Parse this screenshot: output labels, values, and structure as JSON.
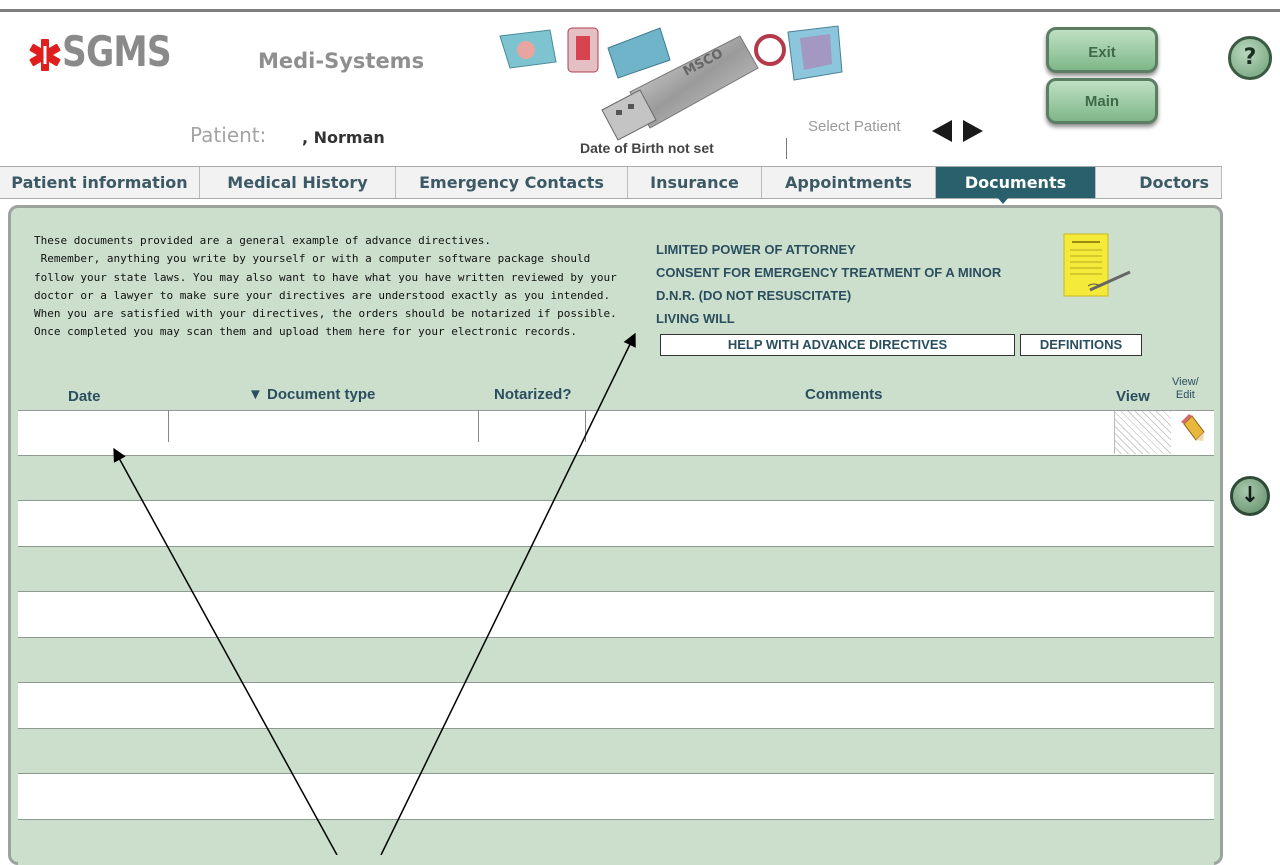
{
  "header": {
    "logo_text": "SGMS",
    "app_name": "Medi-Systems",
    "patient_label": "Patient:",
    "patient_name": ", Norman",
    "dob_text": "Date of Birth not set",
    "select_patient_label": "Select Patient",
    "usb_text": "MSCO"
  },
  "buttons": {
    "exit": "Exit",
    "main": "Main",
    "help": "?",
    "scroll_down": "↓"
  },
  "tabs": [
    {
      "label": "Patient information"
    },
    {
      "label": "Medical History"
    },
    {
      "label": "Emergency Contacts"
    },
    {
      "label": "Insurance"
    },
    {
      "label": "Appointments"
    },
    {
      "label": "Documents",
      "active": true
    },
    {
      "label": "Doctors"
    }
  ],
  "instructions": [
    "These documents provided are a general example of advance directives.",
    " Remember, anything you write by yourself or with a computer software package should",
    "follow your state laws. You may also want to have what you have written reviewed by your",
    "doctor or a lawyer to make sure your directives are understood exactly as you intended.",
    "When you are satisfied with your directives, the orders should be notarized if possible.",
    "Once completed you may scan them and upload them here for your electronic records."
  ],
  "document_links": [
    "LIMITED POWER OF ATTORNEY",
    "CONSENT FOR EMERGENCY TREATMENT OF A MINOR",
    "D.N.R. (DO NOT RESUSCITATE)",
    "LIVING WILL"
  ],
  "help_button": "HELP WITH ADVANCE DIRECTIVES",
  "definitions_button": "DEFINITIONS",
  "table": {
    "columns": [
      "Date",
      "▼ Document type",
      "Notarized?",
      "Comments",
      "View",
      "View/ Edit"
    ],
    "view_edit_top": "View/",
    "view_edit_bottom": "Edit",
    "rows": [
      {
        "date": "",
        "document_type": "",
        "notarized": "",
        "comments": ""
      }
    ]
  },
  "colors": {
    "active_tab": "#29606b",
    "panel_bg": "#ccdfcd",
    "logo_star": "#e01e1e",
    "button_green": "#7eb789"
  },
  "icons": [
    "medical-star-icon",
    "arrow-left-icon",
    "arrow-right-icon",
    "help-icon",
    "document-icon",
    "pencil-icon",
    "arrow-down-icon"
  ]
}
